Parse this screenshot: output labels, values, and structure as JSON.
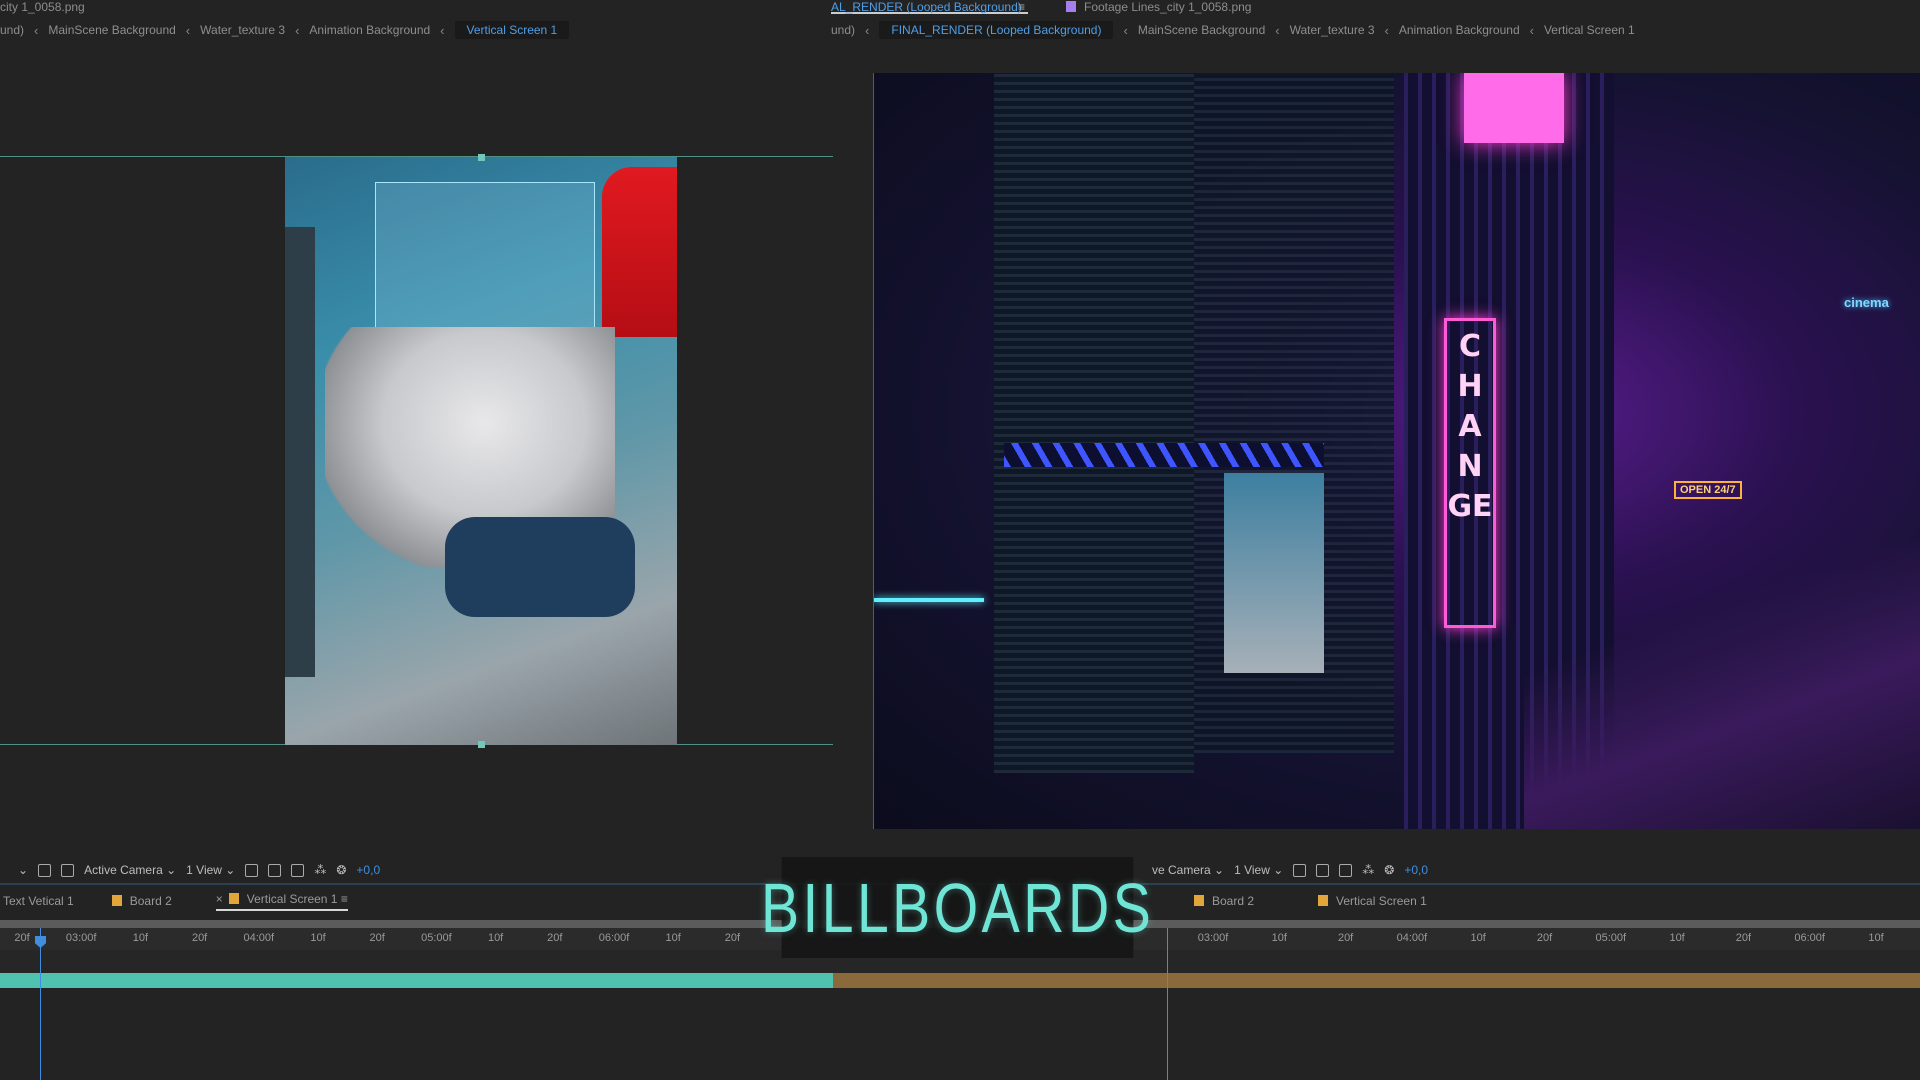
{
  "left_panel": {
    "title": "city 1_0058.png",
    "breadcrumbs": [
      "und)",
      "MainScene Background",
      "Water_texture 3",
      "Animation Background",
      "Vertical Screen 1"
    ],
    "active_crumb": "Vertical Screen 1",
    "toolbar": {
      "camera": "Active Camera",
      "view": "1 View",
      "exposure": "+0,0"
    },
    "tabs": [
      {
        "label": "Text Vetical 1"
      },
      {
        "label": "Board 2"
      },
      {
        "label": "Vertical Screen 1",
        "active": true
      }
    ],
    "ruler": [
      "20f",
      "03:00f",
      "10f",
      "20f",
      "04:00f",
      "10f",
      "20f",
      "05:00f",
      "10f",
      "20f",
      "06:00f",
      "10f",
      "20f"
    ]
  },
  "right_panel": {
    "comp_tab": "AL_RENDER (Looped Background)",
    "footage_tab": "Footage  Lines_city 1_0058.png",
    "breadcrumbs": [
      "und)",
      "FINAL_RENDER (Looped Background)",
      "MainScene Background",
      "Water_texture 3",
      "Animation Background",
      "Vertical Screen 1"
    ],
    "active_crumb": "FINAL_RENDER (Looped Background)",
    "toolbar": {
      "camera": "ve Camera",
      "view": "1 View",
      "exposure": "+0,0"
    },
    "tabs": [
      {
        "label": "Board 2"
      },
      {
        "label": "Vertical Screen 1"
      }
    ],
    "ruler": [
      "03:00f",
      "10f",
      "20f",
      "04:00f",
      "10f",
      "20f",
      "05:00f",
      "10f",
      "20f",
      "06:00f",
      "10f"
    ],
    "sign_text": "CHANGE",
    "sign_small": "OPEN 24/7",
    "sign_cinema": "cinema"
  },
  "overlay": {
    "title": "BILLBOARDS"
  },
  "colors": {
    "accent": "#4f9fe8",
    "work_area": "#4fc3b0",
    "layer_bar": "#8a6a3a",
    "label_swatch": "#e2a53a",
    "title_stroke": "#6fe5d6"
  }
}
